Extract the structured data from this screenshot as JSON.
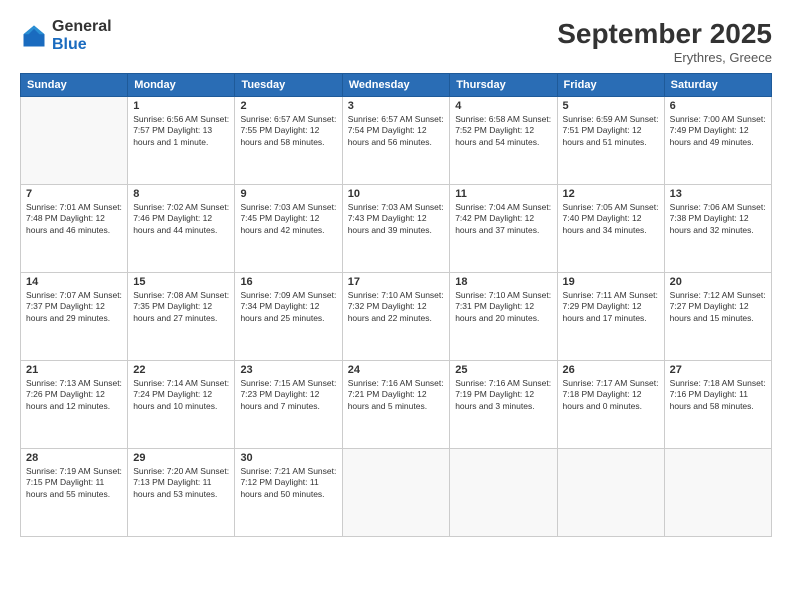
{
  "header": {
    "logo_general": "General",
    "logo_blue": "Blue",
    "title": "September 2025",
    "location": "Erythres, Greece"
  },
  "days_of_week": [
    "Sunday",
    "Monday",
    "Tuesday",
    "Wednesday",
    "Thursday",
    "Friday",
    "Saturday"
  ],
  "weeks": [
    [
      {
        "day": "",
        "info": ""
      },
      {
        "day": "1",
        "info": "Sunrise: 6:56 AM\nSunset: 7:57 PM\nDaylight: 13 hours\nand 1 minute."
      },
      {
        "day": "2",
        "info": "Sunrise: 6:57 AM\nSunset: 7:55 PM\nDaylight: 12 hours\nand 58 minutes."
      },
      {
        "day": "3",
        "info": "Sunrise: 6:57 AM\nSunset: 7:54 PM\nDaylight: 12 hours\nand 56 minutes."
      },
      {
        "day": "4",
        "info": "Sunrise: 6:58 AM\nSunset: 7:52 PM\nDaylight: 12 hours\nand 54 minutes."
      },
      {
        "day": "5",
        "info": "Sunrise: 6:59 AM\nSunset: 7:51 PM\nDaylight: 12 hours\nand 51 minutes."
      },
      {
        "day": "6",
        "info": "Sunrise: 7:00 AM\nSunset: 7:49 PM\nDaylight: 12 hours\nand 49 minutes."
      }
    ],
    [
      {
        "day": "7",
        "info": "Sunrise: 7:01 AM\nSunset: 7:48 PM\nDaylight: 12 hours\nand 46 minutes."
      },
      {
        "day": "8",
        "info": "Sunrise: 7:02 AM\nSunset: 7:46 PM\nDaylight: 12 hours\nand 44 minutes."
      },
      {
        "day": "9",
        "info": "Sunrise: 7:03 AM\nSunset: 7:45 PM\nDaylight: 12 hours\nand 42 minutes."
      },
      {
        "day": "10",
        "info": "Sunrise: 7:03 AM\nSunset: 7:43 PM\nDaylight: 12 hours\nand 39 minutes."
      },
      {
        "day": "11",
        "info": "Sunrise: 7:04 AM\nSunset: 7:42 PM\nDaylight: 12 hours\nand 37 minutes."
      },
      {
        "day": "12",
        "info": "Sunrise: 7:05 AM\nSunset: 7:40 PM\nDaylight: 12 hours\nand 34 minutes."
      },
      {
        "day": "13",
        "info": "Sunrise: 7:06 AM\nSunset: 7:38 PM\nDaylight: 12 hours\nand 32 minutes."
      }
    ],
    [
      {
        "day": "14",
        "info": "Sunrise: 7:07 AM\nSunset: 7:37 PM\nDaylight: 12 hours\nand 29 minutes."
      },
      {
        "day": "15",
        "info": "Sunrise: 7:08 AM\nSunset: 7:35 PM\nDaylight: 12 hours\nand 27 minutes."
      },
      {
        "day": "16",
        "info": "Sunrise: 7:09 AM\nSunset: 7:34 PM\nDaylight: 12 hours\nand 25 minutes."
      },
      {
        "day": "17",
        "info": "Sunrise: 7:10 AM\nSunset: 7:32 PM\nDaylight: 12 hours\nand 22 minutes."
      },
      {
        "day": "18",
        "info": "Sunrise: 7:10 AM\nSunset: 7:31 PM\nDaylight: 12 hours\nand 20 minutes."
      },
      {
        "day": "19",
        "info": "Sunrise: 7:11 AM\nSunset: 7:29 PM\nDaylight: 12 hours\nand 17 minutes."
      },
      {
        "day": "20",
        "info": "Sunrise: 7:12 AM\nSunset: 7:27 PM\nDaylight: 12 hours\nand 15 minutes."
      }
    ],
    [
      {
        "day": "21",
        "info": "Sunrise: 7:13 AM\nSunset: 7:26 PM\nDaylight: 12 hours\nand 12 minutes."
      },
      {
        "day": "22",
        "info": "Sunrise: 7:14 AM\nSunset: 7:24 PM\nDaylight: 12 hours\nand 10 minutes."
      },
      {
        "day": "23",
        "info": "Sunrise: 7:15 AM\nSunset: 7:23 PM\nDaylight: 12 hours\nand 7 minutes."
      },
      {
        "day": "24",
        "info": "Sunrise: 7:16 AM\nSunset: 7:21 PM\nDaylight: 12 hours\nand 5 minutes."
      },
      {
        "day": "25",
        "info": "Sunrise: 7:16 AM\nSunset: 7:19 PM\nDaylight: 12 hours\nand 3 minutes."
      },
      {
        "day": "26",
        "info": "Sunrise: 7:17 AM\nSunset: 7:18 PM\nDaylight: 12 hours\nand 0 minutes."
      },
      {
        "day": "27",
        "info": "Sunrise: 7:18 AM\nSunset: 7:16 PM\nDaylight: 11 hours\nand 58 minutes."
      }
    ],
    [
      {
        "day": "28",
        "info": "Sunrise: 7:19 AM\nSunset: 7:15 PM\nDaylight: 11 hours\nand 55 minutes."
      },
      {
        "day": "29",
        "info": "Sunrise: 7:20 AM\nSunset: 7:13 PM\nDaylight: 11 hours\nand 53 minutes."
      },
      {
        "day": "30",
        "info": "Sunrise: 7:21 AM\nSunset: 7:12 PM\nDaylight: 11 hours\nand 50 minutes."
      },
      {
        "day": "",
        "info": ""
      },
      {
        "day": "",
        "info": ""
      },
      {
        "day": "",
        "info": ""
      },
      {
        "day": "",
        "info": ""
      }
    ]
  ]
}
